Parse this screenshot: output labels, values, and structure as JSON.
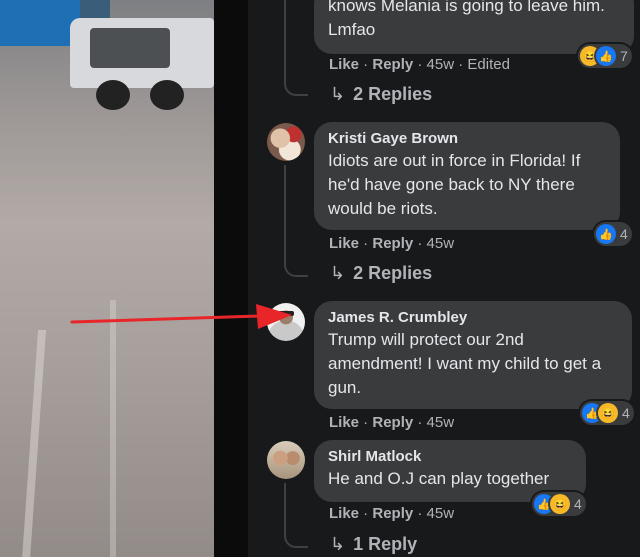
{
  "top_comment": {
    "text_tail": "knows Melania is going to leave him. Lmfao",
    "actions": {
      "like": "Like",
      "reply": "Reply",
      "meta": " · 45w · Edited"
    },
    "reaction_count": "7",
    "replies": "2 Replies"
  },
  "comments": [
    {
      "author": "Kristi Gaye Brown",
      "text": "Idiots are out in force in Florida! If he'd have gone back to NY there would be riots.",
      "actions": {
        "like": "Like",
        "reply": "Reply",
        "meta": " · 45w"
      },
      "reaction_count": "4",
      "replies": "2 Replies"
    },
    {
      "author": "James R. Crumbley",
      "text": "Trump will protect our 2nd amendment! I want my child to get a gun.",
      "actions": {
        "like": "Like",
        "reply": "Reply",
        "meta": " · 45w"
      },
      "reaction_count": "4"
    },
    {
      "author": "Shirl Matlock",
      "text": "He and O.J can play together",
      "actions": {
        "like": "Like",
        "reply": "Reply",
        "meta": " · 45w"
      },
      "reaction_count": "4",
      "replies": "1 Reply"
    }
  ],
  "colors": {
    "panel": "#18191a",
    "bubble": "#3a3b3c",
    "text": "#e4e6eb",
    "muted": "#b0b3b8",
    "like_blue": "#1877f2",
    "arrow_red": "#e8262a"
  }
}
